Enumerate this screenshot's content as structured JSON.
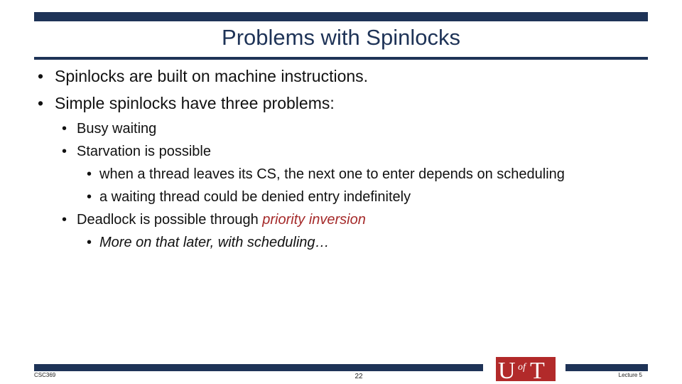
{
  "slide": {
    "title": "Problems with Spinlocks",
    "accent_color": "#1e3357",
    "emphasis_color": "#a52a2a"
  },
  "bullets": [
    {
      "level": 1,
      "text": "Spinlocks are built on machine instructions."
    },
    {
      "level": 1,
      "text": "Simple spinlocks have three problems:"
    },
    {
      "level": 2,
      "text": "Busy waiting"
    },
    {
      "level": 2,
      "text": "Starvation is possible"
    },
    {
      "level": 3,
      "text": "when a thread leaves its CS, the next one to enter depends on scheduling"
    },
    {
      "level": 3,
      "text": "a waiting thread could be denied entry indefinitely"
    },
    {
      "level": 2,
      "text": "Deadlock is possible through ",
      "emphasis": "priority inversion"
    },
    {
      "level": 3,
      "text": "More on that later, with scheduling…"
    }
  ],
  "footer": {
    "course": "CSC369",
    "page_number": "22",
    "lecture": "Lecture 5",
    "logo_text": "UofT"
  }
}
